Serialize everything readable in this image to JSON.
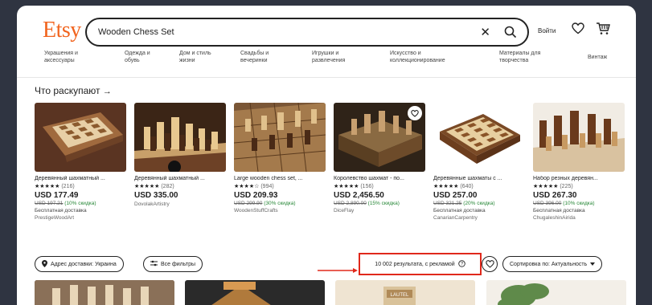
{
  "header": {
    "logo": "Etsy",
    "search_value": "Wooden Chess Set",
    "signin": "Войти"
  },
  "categories": [
    {
      "line1": "Украшения и",
      "line2": "аксессуары"
    },
    {
      "line1": "Одежда и",
      "line2": "обувь"
    },
    {
      "line1": "Дом и стиль",
      "line2": "жизни"
    },
    {
      "line1": "Свадьбы и",
      "line2": "вечеринки"
    },
    {
      "line1": "Игрушки и",
      "line2": "развлечения"
    },
    {
      "line1": "Искусство и",
      "line2": "коллекционирование"
    },
    {
      "line1": "Материалы для",
      "line2": "творчества"
    },
    {
      "line1": "Винтаж",
      "line2": ""
    }
  ],
  "section_title": "Что раскупают",
  "section_arrow": "→",
  "products": [
    {
      "title": "Деревянный шахматный ...",
      "stars": "★★★★★",
      "count": "(216)",
      "price": "USD 177.49",
      "orig": "USD 197.21",
      "disc": "(10% скидка)",
      "ship": "Бесплатная доставка",
      "shop": "PrestigeWoodArt"
    },
    {
      "title": "Деревянный шахматный ...",
      "stars": "★★★★★",
      "count": "(282)",
      "price": "USD 335.00",
      "orig": "",
      "disc": "",
      "ship": "",
      "shop": "DovolakArtistry"
    },
    {
      "title": "Large wooden chess set, ...",
      "stars": "★★★★☆",
      "count": "(994)",
      "price": "USD 209.93",
      "orig": "USD 299.90",
      "disc": "(30% скидка)",
      "ship": "",
      "shop": "WoodenStuffCrafts"
    },
    {
      "title": "Королевство шахмат - по...",
      "stars": "★★★★★",
      "count": "(156)",
      "price": "USD 2,456.50",
      "orig": "USD 2,890.00",
      "disc": "(15% скидка)",
      "ship": "",
      "shop": "DiceFlay"
    },
    {
      "title": "Деревянные шахматы с ...",
      "stars": "★★★★★",
      "count": "(640)",
      "price": "USD 257.00",
      "orig": "USD 321.25",
      "disc": "(20% скидка)",
      "ship": "Бесплатная доставка",
      "shop": "CanarianCarpentry"
    },
    {
      "title": "Набор резных деревян...",
      "stars": "★★★★★",
      "count": "(225)",
      "price": "USD 267.30",
      "orig": "USD 396.00",
      "disc": "(10% скидка)",
      "ship": "Бесплатная доставка",
      "shop": "ChugaleshinAirida"
    }
  ],
  "filters": {
    "delivery": "Адрес доставки: Украина",
    "all_filters": "Все фильтры",
    "results": "10 002 результата, с рекламой",
    "sort": "Сортировка по: Актуальность"
  },
  "colors": {
    "brand": "#f1641e",
    "highlight": "#e0281b",
    "discount": "#258635"
  }
}
